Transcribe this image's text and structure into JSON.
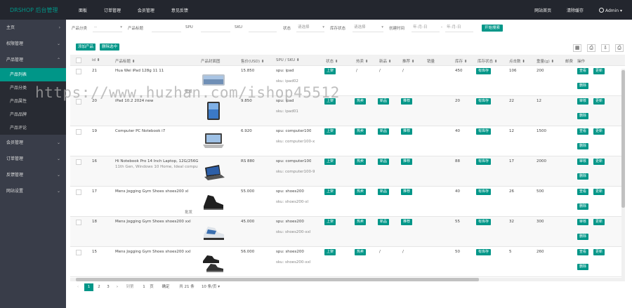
{
  "app": {
    "logo": "DRSHOP 后台管理",
    "top_nav": [
      "面板",
      "订单管理",
      "会员管理",
      "意见反馈"
    ],
    "top_right": [
      "网站首页",
      "清除缓存",
      "Admin"
    ]
  },
  "sidebar": {
    "items": [
      {
        "label": "主页"
      },
      {
        "label": "权限管理"
      },
      {
        "label": "产品管理"
      },
      {
        "label": "会员管理"
      },
      {
        "label": "订单管理"
      },
      {
        "label": "反馈管理"
      },
      {
        "label": "网站设置"
      }
    ],
    "product_sub": [
      "产品列表",
      "产品分类",
      "产品属性",
      "产品品牌",
      "产品评论"
    ]
  },
  "filters": {
    "category_label": "产品分类",
    "category_value": "--",
    "title_label": "产品标题",
    "spu_label": "SPU",
    "sku_label": "SKU",
    "status_label": "状态",
    "status_placeholder": "请选择",
    "stock_label": "库存状态",
    "stock_placeholder": "请选择",
    "created_label": "创建时间",
    "date_from": "年-月-日",
    "date_sep": "-",
    "date_to": "年-月-日",
    "search_button": "开始搜索"
  },
  "actions": {
    "add": "添加产品",
    "delete_selected": "删除选中"
  },
  "toolbar_icons": [
    "columns-icon",
    "print-icon",
    "export-icon",
    "print2-icon"
  ],
  "table": {
    "headers": [
      "id",
      "产品标题",
      "产品封面图",
      "售价(USD)",
      "SPU / SKU",
      "状态",
      "热卖",
      "新品",
      "推荐",
      "销量",
      "库存",
      "库存状态",
      "点击数",
      "重量(g)",
      "邮费",
      "操作"
    ],
    "rows": [
      {
        "id": "21",
        "title": "Hua Wei iPad 128g 11 11",
        "extra": "",
        "price": "15.850",
        "spu": "spu: ipad",
        "sku": "sku: ipad02",
        "status": "上架",
        "hot": "/",
        "new": "/",
        "recommend": "/",
        "sales": "",
        "stock": "450",
        "stock_status": "有库存",
        "clicks": "106",
        "weight": "200",
        "ops": [
          "查看",
          "更新",
          "删除"
        ],
        "img": "ipad-flat",
        "has_row_note": true,
        "note": "批发"
      },
      {
        "id": "20",
        "title": "iPad 10.2 2024 new",
        "extra": "",
        "price": "9.850",
        "spu": "spu: ipad",
        "sku": "sku: ipad01",
        "status": "上架",
        "hot": "热卖",
        "new": "新品",
        "recommend": "推荐",
        "sales": "",
        "stock": "20",
        "stock_status": "有库存",
        "clicks": "22",
        "weight": "12",
        "ops": [
          "审核",
          "更新",
          "删除"
        ],
        "img": "ipad-stand",
        "has_row_note": false,
        "note": ""
      },
      {
        "id": "19",
        "title": "Computer PC Notebook i7",
        "extra": "",
        "price": "6.920",
        "spu": "spu: computer100",
        "sku": "sku: computer100-x",
        "status": "上架",
        "hot": "热卖",
        "new": "新品",
        "recommend": "推荐",
        "sales": "",
        "stock": "40",
        "stock_status": "有库存",
        "clicks": "12",
        "weight": "1500",
        "ops": [
          "查看",
          "更新",
          "删除"
        ],
        "img": "laptop-open",
        "has_row_note": false,
        "note": ""
      },
      {
        "id": "16",
        "title": "Hi Notebook Pro 14 Inch Laptop, 12G/256G",
        "extra": "11th Gen, Windows 10 Home, Ideal computer notebook",
        "price": "RS 880",
        "spu": "spu: computer100",
        "sku": "sku: computer100-9",
        "status": "上架",
        "hot": "热卖",
        "new": "新品",
        "recommend": "推荐",
        "sales": "",
        "stock": "88",
        "stock_status": "有库存",
        "clicks": "17",
        "weight": "2000",
        "ops": [
          "审核",
          "更新",
          "删除"
        ],
        "img": "laptop-angle",
        "has_row_note": false,
        "note": ""
      },
      {
        "id": "17",
        "title": "Mens Jogging Gym Shoes shoes200 xl",
        "extra": "",
        "price": "55.000",
        "spu": "spu: shoes200",
        "sku": "sku: shoes200-xl",
        "status": "上架",
        "hot": "热卖",
        "new": "新品",
        "recommend": "推荐",
        "sales": "",
        "stock": "40",
        "stock_status": "有库存",
        "clicks": "26",
        "weight": "500",
        "ops": [
          "查看",
          "更新",
          "删除"
        ],
        "img": "shoe-black",
        "has_row_note": true,
        "note": "批发"
      },
      {
        "id": "18",
        "title": "Mens Jogging Gym Shoes shoes200 xxl",
        "extra": "",
        "price": "45.000",
        "spu": "spu: shoes200",
        "sku": "sku: shoes200-xxl",
        "status": "上架",
        "hot": "热卖",
        "new": "新品",
        "recommend": "推荐",
        "sales": "",
        "stock": "55",
        "stock_status": "有库存",
        "clicks": "32",
        "weight": "300",
        "ops": [
          "审核",
          "更新",
          "删除"
        ],
        "img": "shoe-white",
        "has_row_note": false,
        "note": ""
      },
      {
        "id": "15",
        "title": "Mens Jogging Gym Shoes shoes200 xxl",
        "extra": "",
        "price": "56.000",
        "spu": "spu: shoes200",
        "sku": "sku: shoes200-xxl",
        "status": "上架",
        "hot": "热卖",
        "new": "/",
        "recommend": "/",
        "sales": "",
        "stock": "50",
        "stock_status": "有库存",
        "clicks": "5",
        "weight": "260",
        "ops": [
          "查看",
          "更新",
          "删除"
        ],
        "img": "shoe-pair",
        "has_row_note": false,
        "note": ""
      }
    ]
  },
  "pagination": {
    "prev": "‹",
    "pages": [
      "1",
      "2",
      "3"
    ],
    "next": "›",
    "goto_label": "到第",
    "goto_value": "1",
    "goto_unit": "页",
    "confirm": "确定",
    "total": "共 21 条",
    "per_page": "10 条/页"
  },
  "watermark": "https://www.huzhan.com/ishop45512",
  "colors": {
    "accent": "#009688",
    "sidebar": "#393d49",
    "topbar": "#23262e"
  }
}
